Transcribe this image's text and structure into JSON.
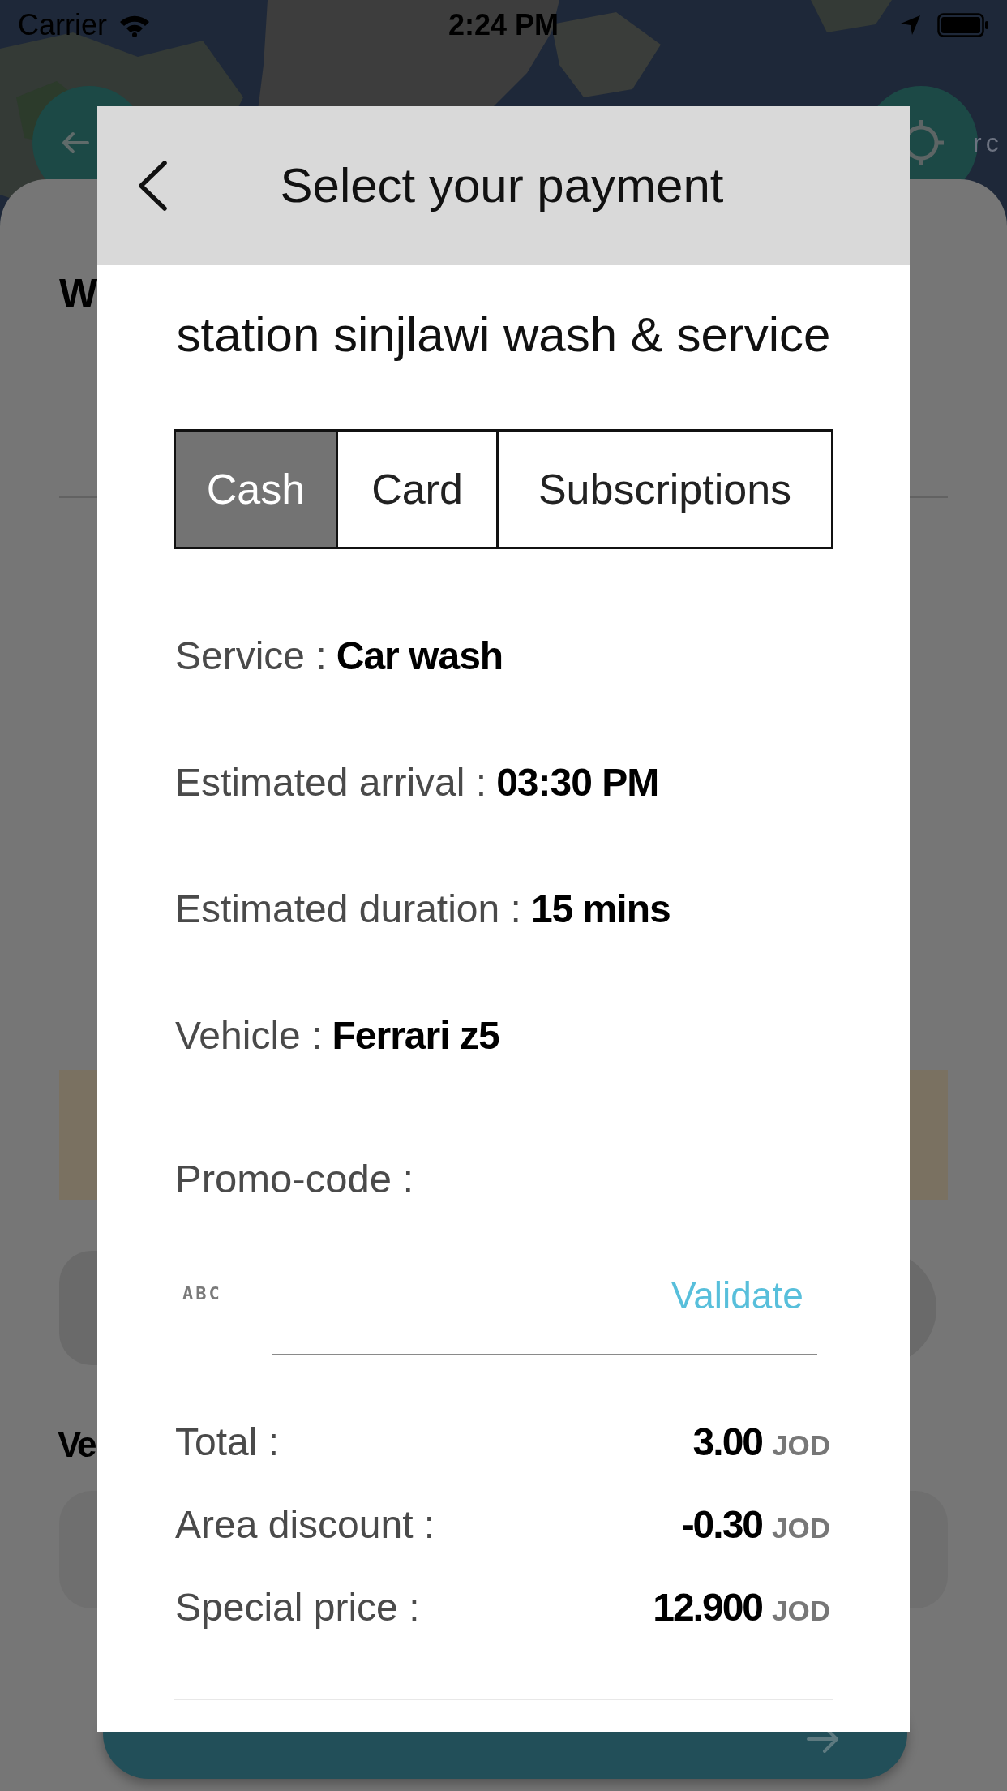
{
  "status_bar": {
    "carrier": "Carrier",
    "time": "2:24 PM"
  },
  "background": {
    "map_label": "rc",
    "sheet_title": "W",
    "section_heading": "Ve"
  },
  "dialog": {
    "title": "Select your payment",
    "station": "station sinjlawi wash & service",
    "tabs": [
      {
        "label": "Cash",
        "selected": true
      },
      {
        "label": "Card",
        "selected": false
      },
      {
        "label": "Subscriptions",
        "selected": false
      }
    ],
    "details": [
      {
        "label": "Service :",
        "value": "Car wash"
      },
      {
        "label": "Estimated arrival :",
        "value": "03:30 PM"
      },
      {
        "label": "Estimated duration :",
        "value": "15 mins"
      },
      {
        "label": "Vehicle :",
        "value": "Ferrari z5"
      }
    ],
    "promo_code": {
      "label": "Promo-code :",
      "prefix": "ABC",
      "action": "Validate"
    },
    "prices": [
      {
        "label": "Total :",
        "amount": "3.00",
        "currency": "JOD"
      },
      {
        "label": "Area discount :",
        "amount": "-0.30",
        "currency": "JOD"
      },
      {
        "label": "Special price :",
        "amount": "12.900",
        "currency": "JOD"
      }
    ]
  }
}
